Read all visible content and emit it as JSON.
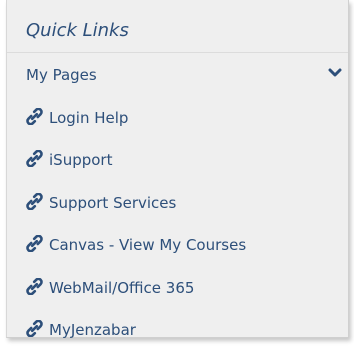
{
  "quick_links": {
    "title": "Quick Links",
    "my_pages_label": "My Pages",
    "items": [
      {
        "label": "Login Help",
        "icon": "link-icon"
      },
      {
        "label": "iSupport",
        "icon": "link-icon"
      },
      {
        "label": "Support Services",
        "icon": "link-icon"
      },
      {
        "label": "Canvas - View My Courses",
        "icon": "link-icon"
      },
      {
        "label": "WebMail/Office 365",
        "icon": "link-icon"
      },
      {
        "label": "MyJenzabar",
        "icon": "link-icon"
      }
    ]
  },
  "colors": {
    "text": "#2d4f7a",
    "panel_bg": "#efefef"
  }
}
